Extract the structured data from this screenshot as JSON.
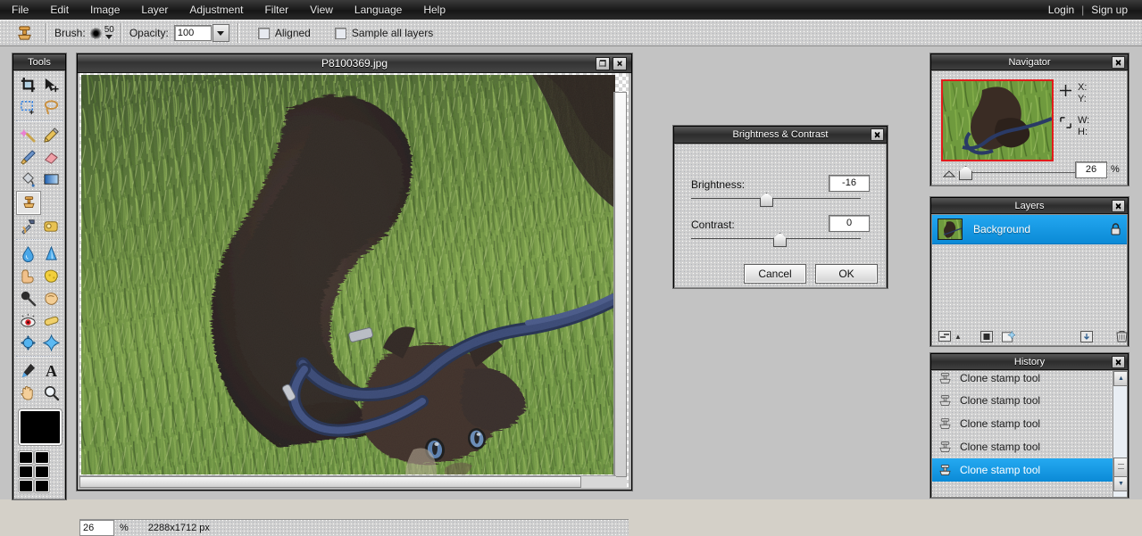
{
  "menu": {
    "items": [
      "File",
      "Edit",
      "Image",
      "Layer",
      "Adjustment",
      "Filter",
      "View",
      "Language",
      "Help"
    ],
    "login": "Login",
    "separator": "|",
    "signup": "Sign up"
  },
  "options_bar": {
    "tool_icon": "clone-stamp-icon",
    "brush_label": "Brush:",
    "brush_size": "50",
    "opacity_label": "Opacity:",
    "opacity_value": "100",
    "aligned_label": "Aligned",
    "aligned_checked": false,
    "sample_all_layers_label": "Sample all layers",
    "sample_all_layers_checked": false
  },
  "tools_panel": {
    "title": "Tools",
    "tools": [
      {
        "name": "crop-tool",
        "icon": "crop-icon"
      },
      {
        "name": "move-tool",
        "icon": "arrow-move-icon"
      },
      {
        "name": "rectangular-marquee-tool",
        "icon": "marquee-icon"
      },
      {
        "name": "lasso-tool",
        "icon": "lasso-icon"
      },
      {
        "name": "magic-wand-tool",
        "icon": "magic-wand-icon"
      },
      {
        "name": "pencil-tool",
        "icon": "pencil-icon"
      },
      {
        "name": "brush-tool",
        "icon": "paintbrush-icon"
      },
      {
        "name": "eraser-tool",
        "icon": "eraser-icon"
      },
      {
        "name": "paint-bucket-tool",
        "icon": "paint-bucket-icon"
      },
      {
        "name": "gradient-tool",
        "icon": "gradient-icon"
      },
      {
        "name": "clone-stamp-tool",
        "icon": "clone-stamp-icon",
        "selected": true
      },
      {
        "name": "retouch-tool",
        "icon": "screwdriver-hammer-icon"
      },
      {
        "name": "shape-tool",
        "icon": "rounded-rect-icon"
      },
      {
        "name": "blur-tool",
        "icon": "water-drop-icon"
      },
      {
        "name": "sharpen-tool",
        "icon": "sharpen-cone-icon"
      },
      {
        "name": "smudge-tool",
        "icon": "finger-smudge-icon"
      },
      {
        "name": "sponge-tool",
        "icon": "sponge-icon"
      },
      {
        "name": "dodge-tool",
        "icon": "dodge-icon"
      },
      {
        "name": "burn-tool",
        "icon": "burn-hand-icon"
      },
      {
        "name": "red-eye-tool",
        "icon": "red-eye-icon"
      },
      {
        "name": "bulge-tool",
        "icon": "capsule-icon"
      },
      {
        "name": "pinch-tool",
        "icon": "sphere-pinch-icon"
      },
      {
        "name": "warp-tool",
        "icon": "star-warp-icon"
      },
      {
        "name": "eyedropper-tool",
        "icon": "eyedropper-icon"
      },
      {
        "name": "type-tool",
        "icon": "text-a-icon"
      },
      {
        "name": "hand-tool",
        "icon": "hand-icon"
      },
      {
        "name": "zoom-tool",
        "icon": "magnifier-icon"
      }
    ],
    "foreground_color": "#000000",
    "palette_colors": [
      "#000000",
      "#000000",
      "#000000",
      "#000000",
      "#000000",
      "#000000"
    ]
  },
  "document": {
    "title": "P8100369.jpg",
    "minimize_label": "❐",
    "close_label": "✕",
    "status_zoom": "26",
    "status_percent": "%",
    "status_dimensions": "2288x1712 px"
  },
  "dialog": {
    "title": "Brightness & Contrast",
    "close_label": "✕",
    "brightness_label": "Brightness:",
    "brightness_value": "-16",
    "contrast_label": "Contrast:",
    "contrast_value": "0",
    "cancel_label": "Cancel",
    "ok_label": "OK"
  },
  "navigator": {
    "title": "Navigator",
    "close_label": "✕",
    "x_label": "X:",
    "y_label": "Y:",
    "w_label": "W:",
    "h_label": "H:",
    "zoom_value": "26",
    "percent_label": "%",
    "position_icon": "crosshair-icon",
    "size_icon": "bounding-box-icon"
  },
  "layers": {
    "title": "Layers",
    "close_label": "✕",
    "rows": [
      {
        "name": "Background",
        "locked": true,
        "selected": true
      }
    ],
    "buttons": [
      {
        "name": "blend-mode-button",
        "icon": "blend-icon"
      },
      {
        "name": "layer-mask-button",
        "icon": "mask-icon"
      },
      {
        "name": "add-layer-button",
        "icon": "new-layer-icon"
      },
      {
        "name": "duplicate-layer-button",
        "icon": "duplicate-icon"
      },
      {
        "name": "delete-layer-button",
        "icon": "trash-icon"
      }
    ]
  },
  "history": {
    "title": "History",
    "close_label": "✕",
    "items": [
      {
        "label": "Clone stamp tool",
        "selected": false
      },
      {
        "label": "Clone stamp tool",
        "selected": false
      },
      {
        "label": "Clone stamp tool",
        "selected": false
      },
      {
        "label": "Clone stamp tool",
        "selected": false
      },
      {
        "label": "Clone stamp tool",
        "selected": true
      }
    ],
    "scroll_up_label": "▲",
    "scroll_down_label": "▼"
  },
  "colors": {
    "accent_blue": "#0b8ad6",
    "panel_gray": "#cfcfcf",
    "titlebar_dark": "#2d2d2d",
    "selection_red": "#e21b1b"
  }
}
